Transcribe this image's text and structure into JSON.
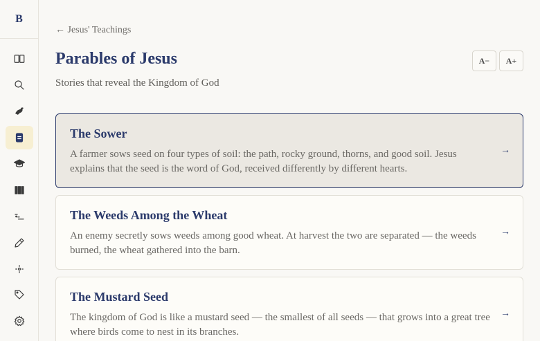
{
  "app": {
    "logo_letter": "B"
  },
  "sidebar": {
    "items": [
      {
        "icon": "book-open-icon"
      },
      {
        "icon": "search-icon"
      },
      {
        "icon": "dove-icon"
      },
      {
        "icon": "document-icon",
        "active": true
      },
      {
        "icon": "graduation-cap-icon"
      },
      {
        "icon": "library-icon"
      },
      {
        "icon": "timeline-icon"
      },
      {
        "icon": "pencil-icon"
      },
      {
        "icon": "compass-icon"
      },
      {
        "icon": "tag-icon"
      },
      {
        "icon": "gear-icon"
      }
    ]
  },
  "header": {
    "breadcrumb": "← Jesus' Teachings",
    "title": "Parables of Jesus",
    "subtitle": "Stories that reveal the Kingdom of God",
    "font_decrease": "A−",
    "font_increase": "A+"
  },
  "parables": [
    {
      "title": "The Sower",
      "description": "A farmer sows seed on four types of soil: the path, rocky ground, thorns, and good soil. Jesus explains that the seed is the word of God, received differently by different hearts.",
      "arrow": "→"
    },
    {
      "title": "The Weeds Among the Wheat",
      "description": "An enemy secretly sows weeds among good wheat. At harvest the two are separated — the weeds burned, the wheat gathered into the barn.",
      "arrow": "→"
    },
    {
      "title": "The Mustard Seed",
      "description": "The kingdom of God is like a mustard seed — the smallest of all seeds — that grows into a great tree where birds come to nest in its branches.",
      "arrow": "→"
    }
  ],
  "colors": {
    "accent": "#2b3a6b",
    "background": "#f9f8f5",
    "active_card": "#ebe8e2",
    "active_nav": "#f7efd2"
  }
}
